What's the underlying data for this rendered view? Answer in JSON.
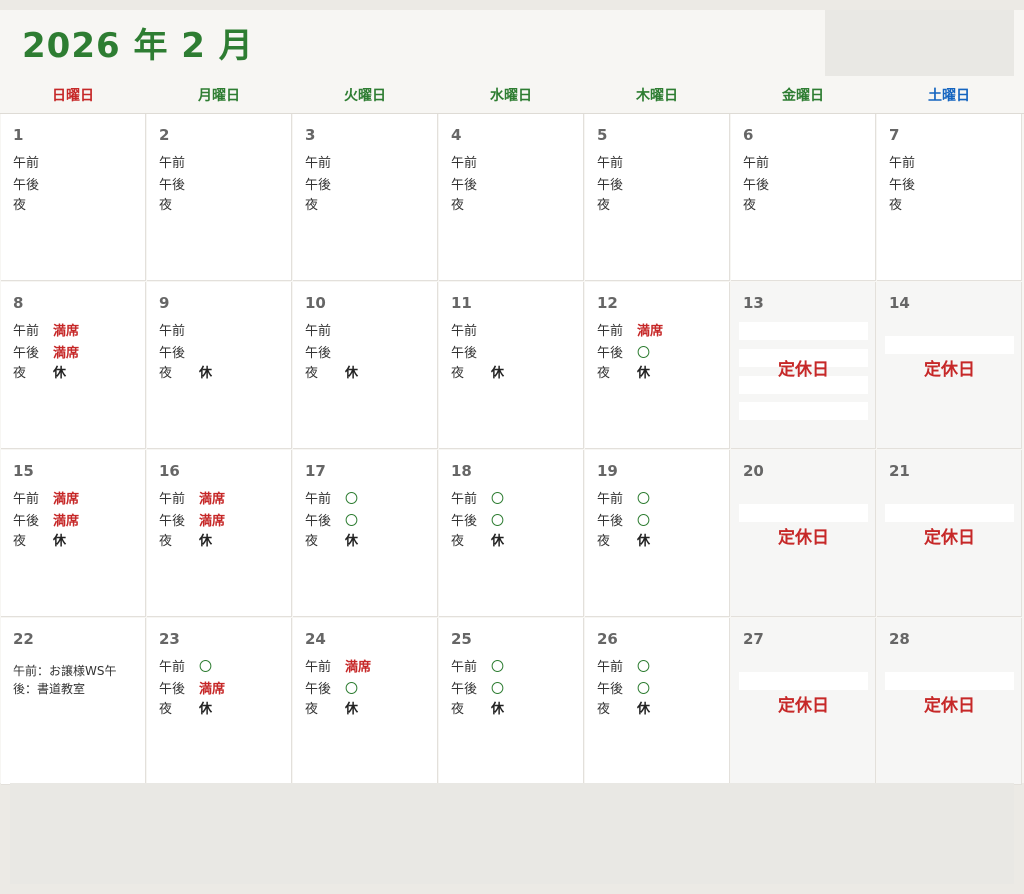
{
  "calendar": {
    "title": "2026 年 2 月",
    "weekdays": [
      {
        "label": "日曜日",
        "color": "#c62828"
      },
      {
        "label": "月曜日",
        "color": "#2e7d32"
      },
      {
        "label": "火曜日",
        "color": "#2e7d32"
      },
      {
        "label": "水曜日",
        "color": "#2e7d32"
      },
      {
        "label": "木曜日",
        "color": "#2e7d32"
      },
      {
        "label": "金曜日",
        "color": "#2e7d32"
      },
      {
        "label": "土曜日",
        "color": "#1565c0"
      }
    ],
    "slot_labels": [
      "午前",
      "午後",
      "夜"
    ],
    "closed_label": "定休日",
    "days": [
      {
        "day": "1",
        "slots": [
          "",
          "",
          ""
        ]
      },
      {
        "day": "2",
        "slots": [
          "",
          "",
          ""
        ]
      },
      {
        "day": "3",
        "slots": [
          "",
          "",
          ""
        ]
      },
      {
        "day": "4",
        "slots": [
          "",
          "",
          ""
        ]
      },
      {
        "day": "5",
        "slots": [
          "",
          "",
          ""
        ]
      },
      {
        "day": "6",
        "slots": [
          "",
          "",
          ""
        ]
      },
      {
        "day": "7",
        "slots": [
          "",
          "",
          ""
        ]
      },
      {
        "day": "8",
        "slots": [
          "満席",
          "満席",
          "休"
        ]
      },
      {
        "day": "9",
        "slots": [
          "",
          "",
          "休"
        ]
      },
      {
        "day": "10",
        "slots": [
          "",
          "",
          "休"
        ]
      },
      {
        "day": "11",
        "slots": [
          "",
          "",
          "休"
        ]
      },
      {
        "day": "12",
        "slots": [
          "満席",
          "〇",
          "休"
        ]
      },
      {
        "day": "13",
        "closed": true
      },
      {
        "day": "14",
        "closed": true
      },
      {
        "day": "15",
        "slots": [
          "満席",
          "満席",
          "休"
        ]
      },
      {
        "day": "16",
        "slots": [
          "満席",
          "満席",
          "休"
        ]
      },
      {
        "day": "17",
        "slots": [
          "〇",
          "〇",
          "休"
        ]
      },
      {
        "day": "18",
        "slots": [
          "〇",
          "〇",
          "休"
        ]
      },
      {
        "day": "19",
        "slots": [
          "〇",
          "〇",
          "休"
        ]
      },
      {
        "day": "20",
        "closed": true
      },
      {
        "day": "21",
        "closed": true
      },
      {
        "day": "22",
        "note": "午前：お譲様WS午後：書道教室"
      },
      {
        "day": "23",
        "slots": [
          "〇",
          "満席",
          "休"
        ]
      },
      {
        "day": "24",
        "slots": [
          "満席",
          "〇",
          "休"
        ]
      },
      {
        "day": "25",
        "slots": [
          "〇",
          "〇",
          "休"
        ]
      },
      {
        "day": "26",
        "slots": [
          "〇",
          "〇",
          "休"
        ]
      },
      {
        "day": "27",
        "closed": true
      },
      {
        "day": "28",
        "closed": true
      }
    ]
  }
}
